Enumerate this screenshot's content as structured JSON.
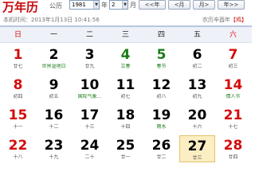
{
  "header": {
    "logo": "万年历",
    "calendar_type": "公历",
    "year_value": "1981",
    "year_unit": "年",
    "month_value": "2",
    "month_unit": "月",
    "nav_buttons": [
      "<<年",
      "<月",
      "月>",
      "年>>"
    ],
    "arrow_glyph": "▼"
  },
  "status": {
    "current_time": "本机时间：2013年1月13日 10:41:56",
    "lunar_year": "农历辛酉年",
    "zodiac": "【鸡】"
  },
  "weekdays": [
    "日",
    "一",
    "二",
    "三",
    "四",
    "五",
    "六"
  ],
  "weeks": [
    [
      {
        "day": "1",
        "sub": "廿七",
        "style": "red"
      },
      {
        "day": "2",
        "sub": "世界湿地日",
        "style": "",
        "subStyle": "g"
      },
      {
        "day": "3",
        "sub": "廿九",
        "style": ""
      },
      {
        "day": "4",
        "sub": "立春",
        "style": "green",
        "subStyle": "g"
      },
      {
        "day": "5",
        "sub": "春节",
        "style": "green",
        "subStyle": "g"
      },
      {
        "day": "6",
        "sub": "初二",
        "style": ""
      },
      {
        "day": "7",
        "sub": "初三",
        "style": "red"
      }
    ],
    [
      {
        "day": "8",
        "sub": "初四",
        "style": "red"
      },
      {
        "day": "9",
        "sub": "初五",
        "style": ""
      },
      {
        "day": "10",
        "sub": "国际气象...",
        "style": "",
        "subStyle": "g"
      },
      {
        "day": "11",
        "sub": "初七",
        "style": ""
      },
      {
        "day": "12",
        "sub": "初八",
        "style": ""
      },
      {
        "day": "13",
        "sub": "初九",
        "style": ""
      },
      {
        "day": "14",
        "sub": "情人节",
        "style": "red",
        "subStyle": "g"
      }
    ],
    [
      {
        "day": "15",
        "sub": "十一",
        "style": "red"
      },
      {
        "day": "16",
        "sub": "十二",
        "style": ""
      },
      {
        "day": "17",
        "sub": "十三",
        "style": ""
      },
      {
        "day": "18",
        "sub": "十四",
        "style": ""
      },
      {
        "day": "19",
        "sub": "雨水",
        "style": "",
        "subStyle": "g"
      },
      {
        "day": "20",
        "sub": "十六",
        "style": ""
      },
      {
        "day": "21",
        "sub": "十七",
        "style": "red"
      }
    ],
    [
      {
        "day": "22",
        "sub": "十八",
        "style": "red"
      },
      {
        "day": "23",
        "sub": "十九",
        "style": ""
      },
      {
        "day": "24",
        "sub": "二十",
        "style": ""
      },
      {
        "day": "25",
        "sub": "廿一",
        "style": ""
      },
      {
        "day": "26",
        "sub": "廿二",
        "style": ""
      },
      {
        "day": "27",
        "sub": "廿三",
        "style": "today"
      },
      {
        "day": "28",
        "sub": "廿四",
        "style": "red"
      }
    ]
  ],
  "colors": {
    "red": "#d40c0c",
    "green": "#1c7c1a",
    "today_bg": "#fbeec2",
    "header_bg": "#eef2f8"
  }
}
